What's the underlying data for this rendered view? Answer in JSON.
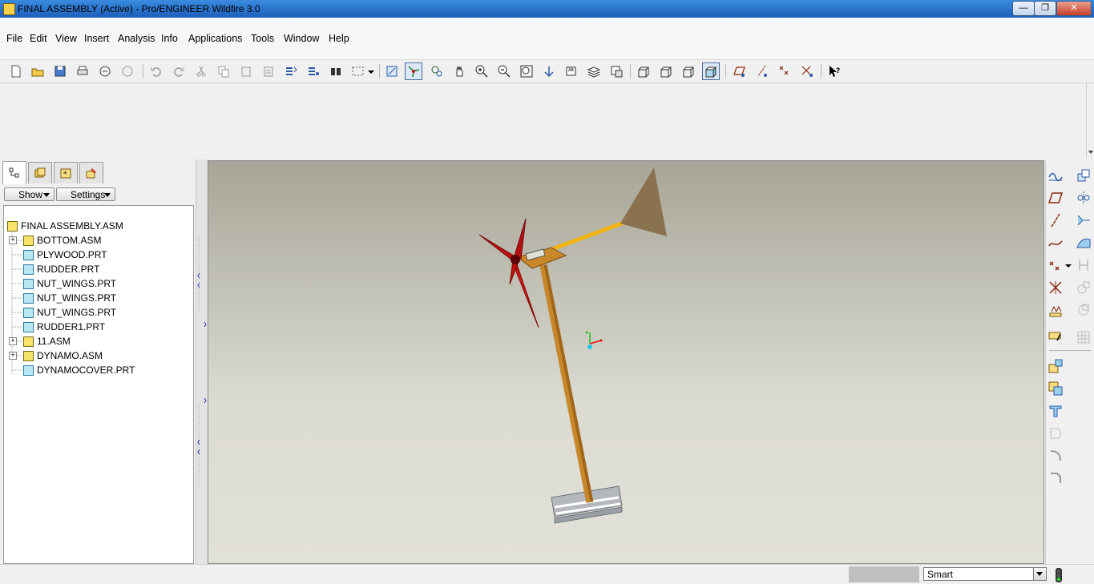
{
  "window": {
    "title": "FINAL ASSEMBLY (Active) - Pro/ENGINEER Wildfire 3.0",
    "controls": {
      "minimize": "—",
      "maximize": "❐",
      "close": "✕"
    }
  },
  "menu": {
    "items": [
      "File",
      "Edit",
      "View",
      "Insert",
      "Analysis",
      "Info",
      "Applications",
      "Tools",
      "Window",
      "Help"
    ]
  },
  "toolbar": {
    "icons": [
      "new-icon",
      "open-icon",
      "save-icon",
      "print-icon",
      "send-email-icon",
      "send-link-icon",
      "undo-icon",
      "redo-icon",
      "cut-icon",
      "copy-icon",
      "paste-icon",
      "paste-special-icon",
      "regenerate-icon",
      "regen-manager-icon",
      "find-icon",
      "select-box-icon",
      "repaint-icon",
      "spin-center-icon",
      "orient-mode-icon",
      "pan-icon",
      "zoom-in-icon",
      "zoom-out-icon",
      "refit-icon",
      "reorient-icon",
      "saved-views-icon",
      "layers-icon",
      "view-manager-icon",
      "wireframe-icon",
      "hidden-line-icon",
      "no-hidden-icon",
      "shading-icon",
      "datum-planes-icon",
      "datum-axes-icon",
      "datum-points-icon",
      "coord-systems-icon",
      "context-help-icon"
    ]
  },
  "nav": {
    "tabs": [
      "model-tree-tab",
      "folder-browser-tab",
      "favorites-tab",
      "connections-tab"
    ],
    "show_label": "Show",
    "settings_label": "Settings",
    "tree": [
      {
        "label": "FINAL ASSEMBLY.ASM",
        "kind": "asm",
        "level": 0,
        "expand": false
      },
      {
        "label": "BOTTOM.ASM",
        "kind": "asm",
        "level": 1,
        "expand": true
      },
      {
        "label": "PLYWOOD.PRT",
        "kind": "prt",
        "level": 1,
        "expand": false
      },
      {
        "label": "RUDDER.PRT",
        "kind": "prt",
        "level": 1,
        "expand": false
      },
      {
        "label": "NUT_WINGS.PRT",
        "kind": "prt",
        "level": 1,
        "expand": false
      },
      {
        "label": "NUT_WINGS.PRT",
        "kind": "prt",
        "level": 1,
        "expand": false
      },
      {
        "label": "NUT_WINGS.PRT",
        "kind": "prt",
        "level": 1,
        "expand": false
      },
      {
        "label": "RUDDER1.PRT",
        "kind": "prt",
        "level": 1,
        "expand": false
      },
      {
        "label": "11.ASM",
        "kind": "asm",
        "level": 1,
        "expand": true
      },
      {
        "label": "DYNAMO.ASM",
        "kind": "asm",
        "level": 1,
        "expand": true
      },
      {
        "label": "DYNAMOCOVER.PRT",
        "kind": "prt",
        "level": 1,
        "expand": false
      }
    ]
  },
  "colors": {
    "blade": "#c01010",
    "shaft": "#c8882a",
    "tail_boom": "#f2b414",
    "tail_fin": "#8a7250",
    "base": "#b4b8bc"
  },
  "status": {
    "filter_value": "Smart"
  }
}
